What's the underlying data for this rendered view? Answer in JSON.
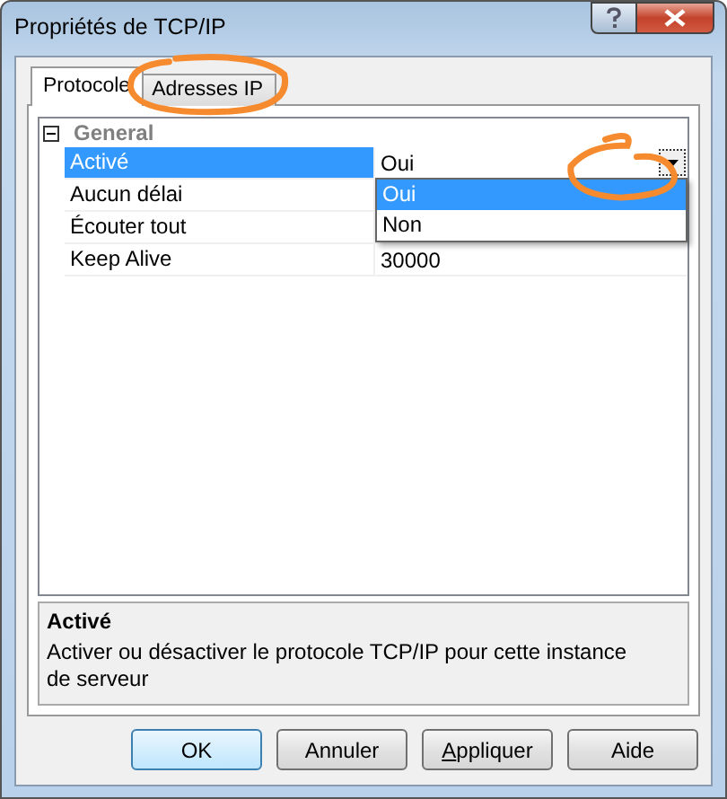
{
  "window": {
    "title": "Propriétés de TCP/IP"
  },
  "tabs": [
    {
      "label": "Protocole",
      "selected": true,
      "circled": false
    },
    {
      "label": "Adresses IP",
      "selected": false,
      "circled": true
    }
  ],
  "grid": {
    "category": {
      "label": "General",
      "expanded": true
    },
    "properties": [
      {
        "name": "Activé",
        "value": "Oui",
        "selected": true,
        "editing": true,
        "dropdown_circled": true
      },
      {
        "name": "Aucun délai",
        "selected": false,
        "editing": false
      },
      {
        "name": "Écouter tout",
        "selected": false,
        "editing": false
      },
      {
        "name": "Keep Alive",
        "value": "30000",
        "selected": false,
        "editing": false
      }
    ]
  },
  "dropdown": {
    "options": [
      {
        "label": "Oui",
        "selected": true
      },
      {
        "label": "Non",
        "selected": false
      }
    ]
  },
  "description": {
    "title": "Activé",
    "text": "Activer ou désactiver le protocole TCP/IP pour cette instance de serveur"
  },
  "buttons": [
    {
      "label": "OK",
      "default": true,
      "first_letter_underlined": false
    },
    {
      "label": "Annuler",
      "default": false,
      "first_letter_underlined": false
    },
    {
      "label": "Appliquer",
      "default": false,
      "first_letter_underlined": true
    },
    {
      "label": "Aide",
      "default": false,
      "first_letter_underlined": false
    }
  ]
}
